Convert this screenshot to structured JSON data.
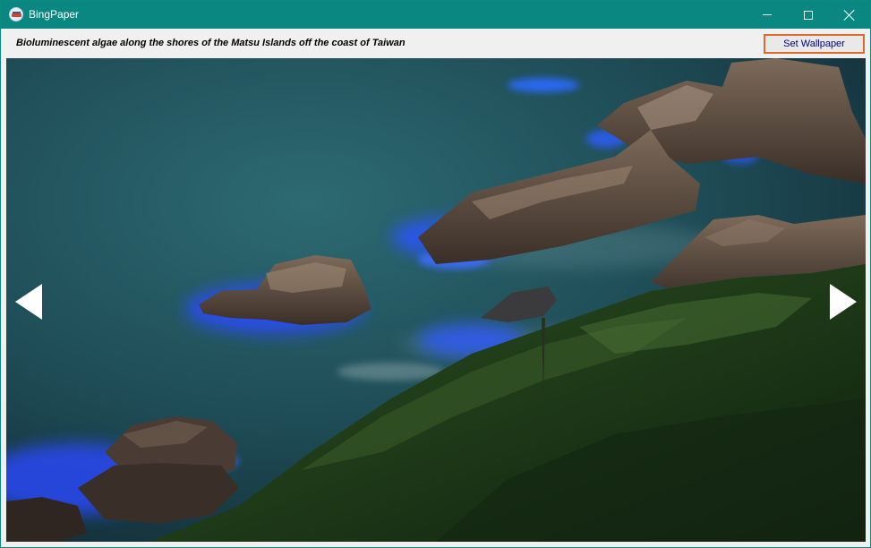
{
  "window": {
    "title": "BingPaper",
    "icon": "bingpaper-app-icon",
    "controls": [
      "minimize-icon",
      "maximize-icon",
      "close-icon"
    ],
    "accent_color": "#0b8781"
  },
  "toolbar": {
    "caption": "Bioluminescent algae along the shores of the Matsu Islands off the coast of Taiwan",
    "set_wallpaper_label": "Set Wallpaper",
    "button_border_color": "#e06a2c"
  },
  "viewer": {
    "prev_icon": "arrow-left-icon",
    "next_icon": "arrow-right-icon"
  }
}
